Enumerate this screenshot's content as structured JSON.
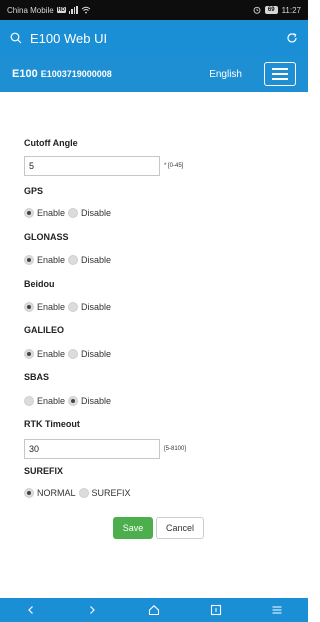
{
  "status_bar": {
    "carrier": "China Mobile",
    "hd": "HD",
    "battery": "69",
    "time": "11:27"
  },
  "browser": {
    "title": "E100 Web UI"
  },
  "header": {
    "model": "E100",
    "serial": "E1003719000008",
    "language": "English"
  },
  "form": {
    "cutoff_angle": {
      "label": "Cutoff Angle",
      "value": "5",
      "hint": "* [0-45]"
    },
    "gps": {
      "label": "GPS",
      "enable": "Enable",
      "disable": "Disable",
      "selected": "Enable"
    },
    "glonass": {
      "label": "GLONASS",
      "enable": "Enable",
      "disable": "Disable",
      "selected": "Enable"
    },
    "beidou": {
      "label": "Beidou",
      "enable": "Enable",
      "disable": "Disable",
      "selected": "Enable"
    },
    "galileo": {
      "label": "GALILEO",
      "enable": "Enable",
      "disable": "Disable",
      "selected": "Enable"
    },
    "sbas": {
      "label": "SBAS",
      "enable": "Enable",
      "disable": "Disable",
      "selected": "Disable"
    },
    "rtk_timeout": {
      "label": "RTK Timeout",
      "value": "30",
      "hint": "[5-8100]"
    },
    "surefix": {
      "label": "SUREFIX",
      "normal": "NORMAL",
      "surefix": "SUREFIX",
      "selected": "NORMAL"
    },
    "save_label": "Save",
    "cancel_label": "Cancel"
  },
  "colors": {
    "header_blue": "#1f8fd3",
    "save_green": "#4cae4c"
  }
}
